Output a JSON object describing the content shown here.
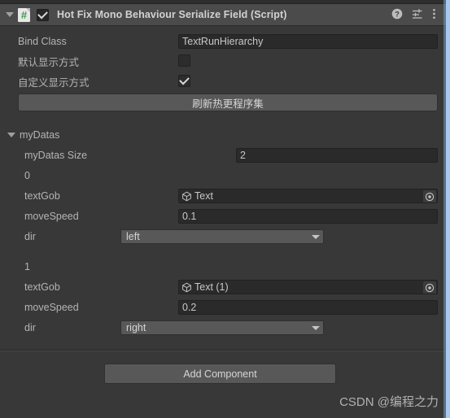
{
  "window": {
    "background_color": "#383838",
    "header_color": "#4b4b4b",
    "accent_color": "#a8c8ec"
  },
  "component_header": {
    "foldout_icon": "triangle-down-icon",
    "script_icon": "csharp-script-icon",
    "script_icon_glyph": "#",
    "enabled": true,
    "enabled_checkmark": "check-icon",
    "title": "Hot Fix Mono Behaviour Serialize Field (Script)",
    "icons": [
      {
        "name": "help-icon",
        "glyph": "?"
      },
      {
        "name": "preset-icon",
        "glyph": "sliders"
      },
      {
        "name": "more-menu-icon",
        "glyph": "kebab"
      }
    ]
  },
  "properties": {
    "bind_class": {
      "label": "Bind Class",
      "value": "TextRunHierarchy"
    },
    "default_display_mode": {
      "label": "默认显示方式",
      "checked": false
    },
    "custom_display_mode": {
      "label": "自定义显示方式",
      "checked": true
    },
    "refresh_button": {
      "label": "刷新热更程序集"
    }
  },
  "array": {
    "label": "myDatas",
    "expanded": true,
    "foldout_icon": "triangle-down-icon",
    "size_label": "myDatas Size",
    "size_value": "2",
    "field_labels": {
      "textGob": "textGob",
      "moveSpeed": "moveSpeed",
      "dir": "dir"
    },
    "object_picker_icon": "object-picker-icon",
    "gameobject_icon": "gameobject-cube-icon",
    "dropdown_arrow_icon": "chevron-down-icon",
    "elements": [
      {
        "index_label": "0",
        "textGob": "Text",
        "moveSpeed": "0.1",
        "dir": "left"
      },
      {
        "index_label": "1",
        "textGob": "Text (1)",
        "moveSpeed": "0.2",
        "dir": "right"
      }
    ]
  },
  "footer": {
    "add_component_label": "Add Component",
    "watermark": "CSDN @编程之力"
  }
}
